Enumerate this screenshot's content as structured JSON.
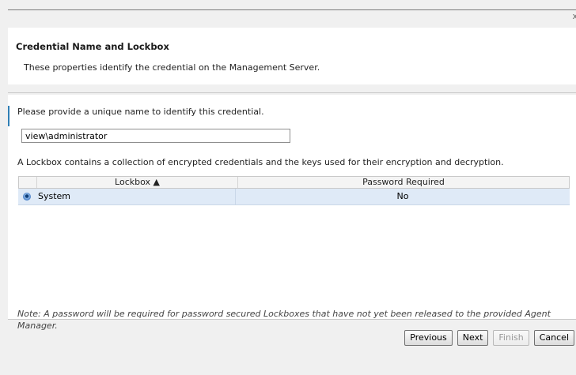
{
  "window": {
    "close_glyph": "x"
  },
  "header": {
    "title": "Credential Name and Lockbox",
    "description": "These properties identify the credential on the Management Server."
  },
  "form": {
    "name_prompt": "Please provide a unique name to identify this credential.",
    "name_value": "view\\administrator",
    "lockbox_info": "A Lockbox contains a collection of encrypted credentials and the keys used for their encryption and decryption."
  },
  "lockbox_table": {
    "columns": [
      "",
      "Lockbox ▲",
      "Password Required"
    ],
    "rows": [
      {
        "lockbox": "System",
        "password_required": "No",
        "selected": true
      }
    ]
  },
  "note": "Note: A password will be required for password secured Lockboxes that have not yet been released to the provided Agent Manager.",
  "buttons": {
    "previous": "Previous",
    "next": "Next",
    "finish": "Finish",
    "cancel": "Cancel"
  }
}
